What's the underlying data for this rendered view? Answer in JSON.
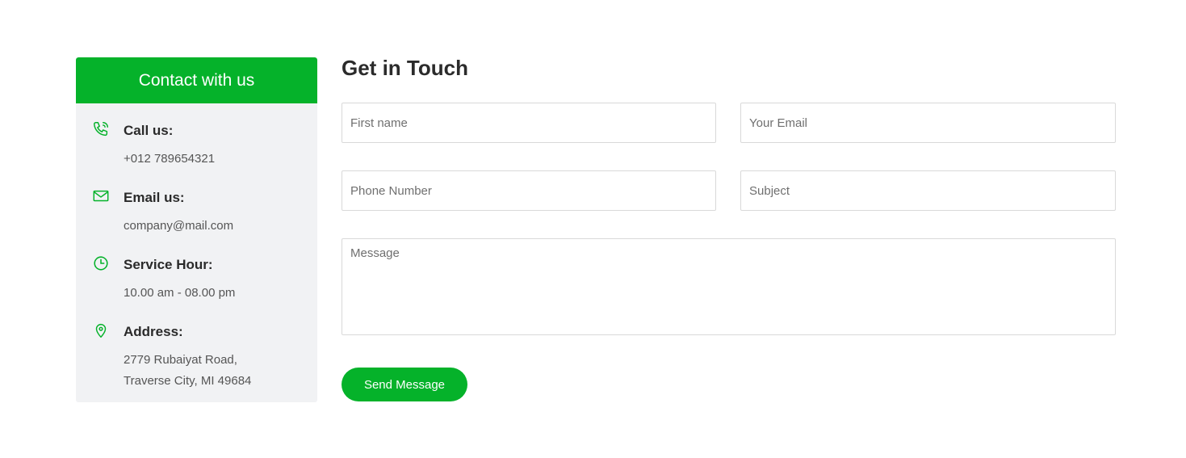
{
  "contact": {
    "header": "Contact with us",
    "items": [
      {
        "icon": "phone-icon",
        "label": "Call us:",
        "lines": [
          "+012 789654321"
        ]
      },
      {
        "icon": "mail-icon",
        "label": "Email us:",
        "lines": [
          "company@mail.com"
        ]
      },
      {
        "icon": "clock-icon",
        "label": "Service Hour:",
        "lines": [
          "10.00 am - 08.00 pm"
        ]
      },
      {
        "icon": "location-pin-icon",
        "label": "Address:",
        "lines": [
          "2779 Rubaiyat Road,",
          "Traverse City, MI 49684"
        ]
      }
    ]
  },
  "form": {
    "title": "Get in Touch",
    "first_name": {
      "placeholder": "First name",
      "value": ""
    },
    "email": {
      "placeholder": "Your Email",
      "value": ""
    },
    "phone": {
      "placeholder": "Phone Number",
      "value": ""
    },
    "subject": {
      "placeholder": "Subject",
      "value": ""
    },
    "message": {
      "placeholder": "Message",
      "value": ""
    },
    "submit_label": "Send Message"
  },
  "colors": {
    "accent": "#05b22a",
    "card_bg": "#f1f2f4"
  }
}
